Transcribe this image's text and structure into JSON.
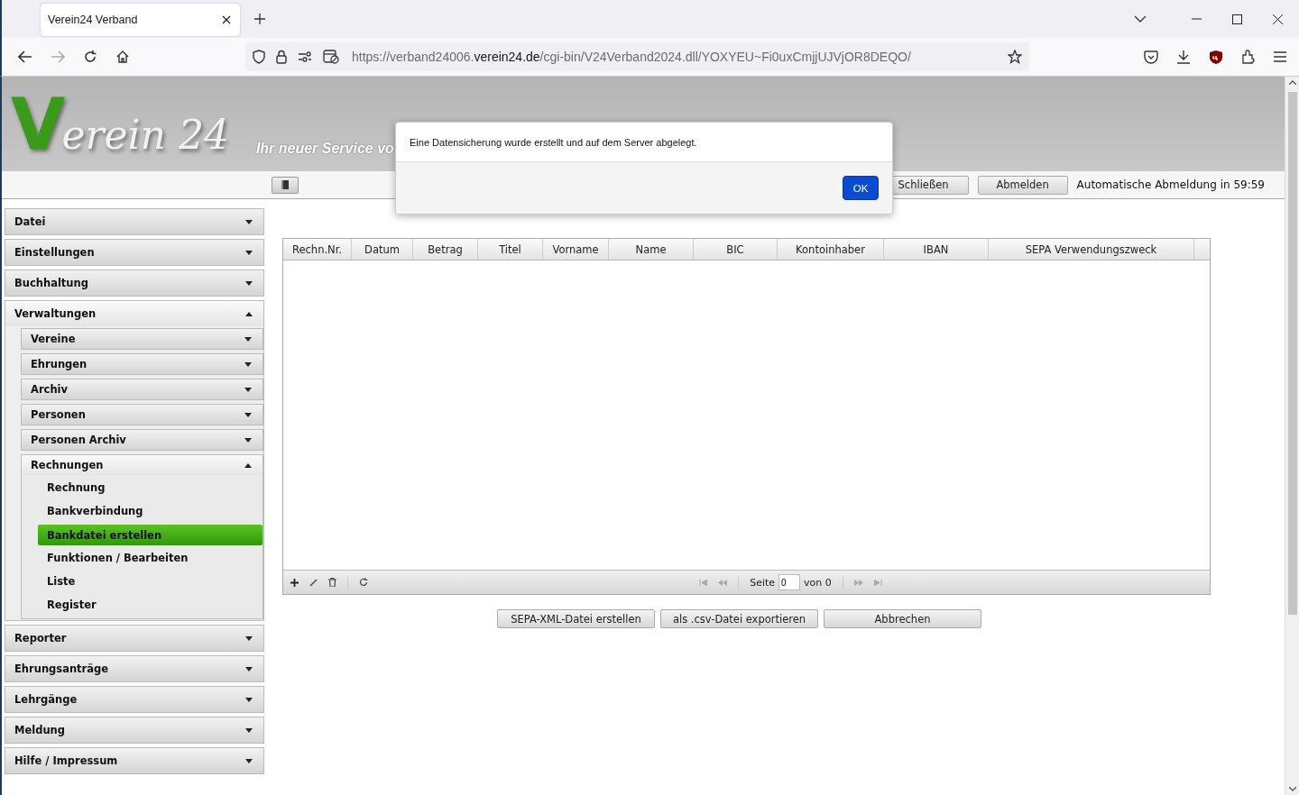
{
  "browser": {
    "tab_title": "Verein24 Verband",
    "url": {
      "prefix": "https://verband24006.",
      "domain": "verein24.de",
      "path": "/cgi-bin/V24Verband2024.dll/YOXYEU~Fi0uxCmjjUJVjOR8DEQO/"
    }
  },
  "header": {
    "logo_letter": "V",
    "logo_text": "erein 24",
    "tagline": "Ihr neuer Service vo"
  },
  "toolbar": {
    "buttons": [
      "Schließen",
      "Abmelden"
    ],
    "logout_timer": "Automatische Abmeldung in 59:59"
  },
  "sidebar": [
    {
      "label": "Datei",
      "expanded": false
    },
    {
      "label": "Einstellungen",
      "expanded": false
    },
    {
      "label": "Buchhaltung",
      "expanded": false
    },
    {
      "label": "Verwaltungen",
      "expanded": true,
      "children": [
        {
          "label": "Vereine",
          "expanded": false
        },
        {
          "label": "Ehrungen",
          "expanded": false
        },
        {
          "label": "Archiv",
          "expanded": false
        },
        {
          "label": "Personen",
          "expanded": false
        },
        {
          "label": "Personen Archiv",
          "expanded": false
        },
        {
          "label": "Rechnungen",
          "expanded": true,
          "children": [
            {
              "label": "Rechnung",
              "selected": false
            },
            {
              "label": "Bankverbindung",
              "selected": false
            },
            {
              "label": "Bankdatei erstellen",
              "selected": true
            },
            {
              "label": "Funktionen / Bearbeiten",
              "selected": false
            },
            {
              "label": "Liste",
              "selected": false
            },
            {
              "label": "Register",
              "selected": false
            }
          ]
        }
      ]
    },
    {
      "label": "Reporter",
      "expanded": false
    },
    {
      "label": "Ehrungsanträge",
      "expanded": false
    },
    {
      "label": "Lehrgänge",
      "expanded": false
    },
    {
      "label": "Meldung",
      "expanded": false
    },
    {
      "label": "Hilfe / Impressum",
      "expanded": false
    }
  ],
  "table": {
    "columns": [
      "Rechn.Nr.",
      "Datum",
      "Betrag",
      "Titel",
      "Vorname",
      "Name",
      "BIC",
      "Kontoinhaber",
      "IBAN",
      "SEPA Verwendungszweck"
    ],
    "pager": {
      "page_label": "Seite",
      "page_value": "0",
      "of_label": "von 0"
    }
  },
  "actions": [
    "SEPA-XML-Datei erstellen",
    "als .csv-Datei exportieren",
    "Abbrechen"
  ],
  "dialog": {
    "message": "Eine Datensicherung wurde erstellt und auf dem Server abgelegt.",
    "button": "OK"
  }
}
